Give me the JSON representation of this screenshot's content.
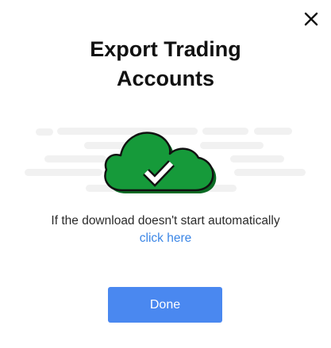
{
  "dialog": {
    "title_line1": "Export Trading",
    "title_line2": "Accounts",
    "close_icon": "close-icon",
    "illustration_icon": "cloud-checkmark-icon",
    "message": "If the download doesn't start automatically",
    "link_label": "click here",
    "done_label": "Done"
  },
  "colors": {
    "title": "#111111",
    "link": "#3b86e6",
    "button": "#4a88f0",
    "cloud_fill": "#169a3a",
    "cloud_shadow": "#0a6b24",
    "placeholder_lines": "#f1f1f1"
  }
}
